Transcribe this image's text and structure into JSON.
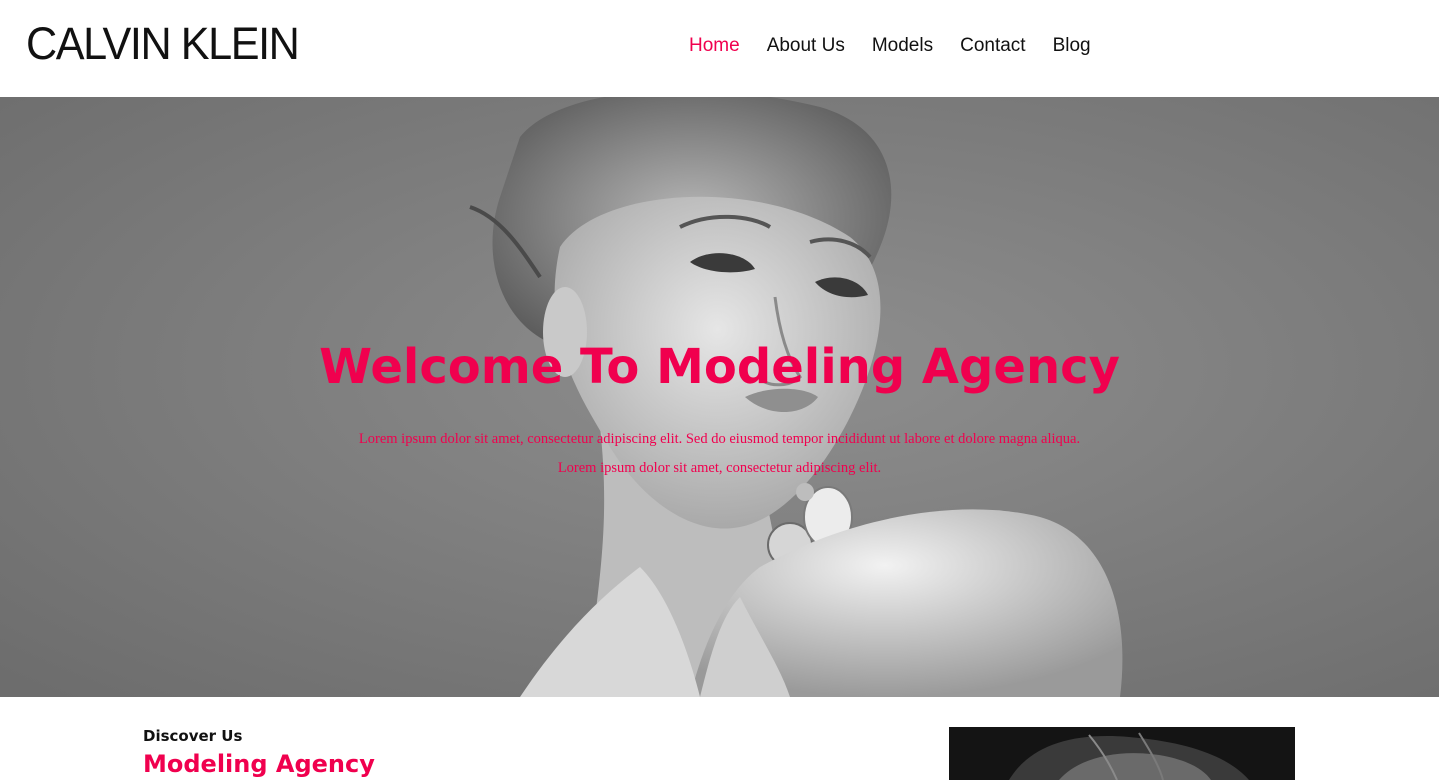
{
  "brand": {
    "logo_text": "CALVIN KLEIN",
    "accent_color": "#f0004e"
  },
  "nav": {
    "items": [
      {
        "label": "Home",
        "active": true
      },
      {
        "label": "About Us",
        "active": false
      },
      {
        "label": "Models",
        "active": false
      },
      {
        "label": "Contact",
        "active": false
      },
      {
        "label": "Blog",
        "active": false
      }
    ]
  },
  "hero": {
    "title": "Welcome To Modeling Agency",
    "text_line_1": "Lorem ipsum dolor sit amet, consectetur adipiscing elit. Sed do eiusmod tempor incididunt ut labore et dolore magna aliqua.",
    "text_line_2": "Lorem ipsum dolor sit amet, consectetur adipiscing elit."
  },
  "discover": {
    "kicker": "Discover Us",
    "title": "Modeling Agency"
  }
}
